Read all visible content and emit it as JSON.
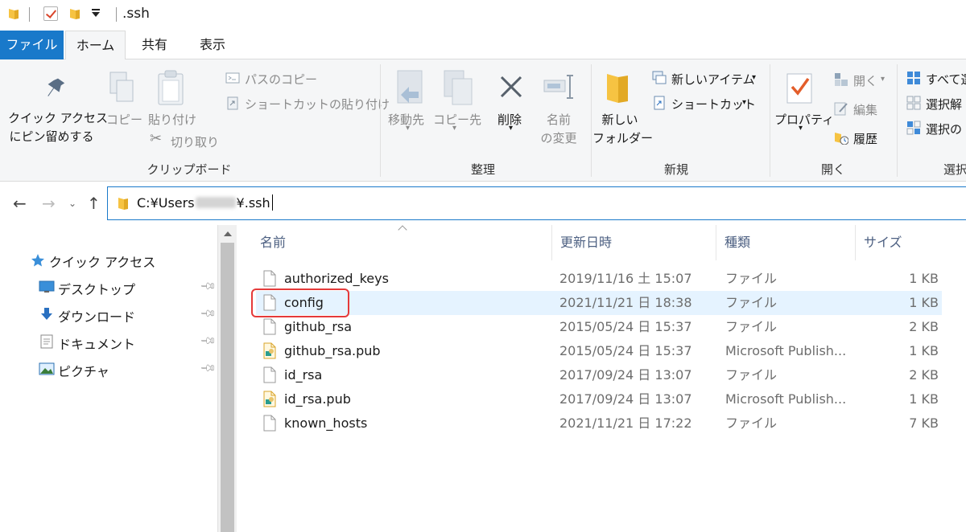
{
  "window": {
    "title": ".ssh"
  },
  "tabs": [
    {
      "label": "ファイル"
    },
    {
      "label": "ホーム"
    },
    {
      "label": "共有"
    },
    {
      "label": "表示"
    }
  ],
  "ribbon": {
    "clipboard": {
      "label": "クリップボード",
      "pin_line1": "クイック アクセス",
      "pin_line2": "にピン留めする",
      "copy": "コピー",
      "paste": "貼り付け",
      "cut": "切り取り",
      "copy_path": "パスのコピー",
      "paste_shortcut": "ショートカットの貼り付け"
    },
    "organize": {
      "label": "整理",
      "move_to": "移動先",
      "copy_to": "コピー先",
      "delete": "削除",
      "rename_line1": "名前",
      "rename_line2": "の変更"
    },
    "new": {
      "label": "新規",
      "new_folder_line1": "新しい",
      "new_folder_line2": "フォルダー",
      "new_item": "新しいアイテム",
      "shortcut": "ショートカット"
    },
    "open": {
      "label": "開く",
      "properties": "プロパティ",
      "open": "開く",
      "edit": "編集",
      "history": "履歴"
    },
    "select": {
      "label": "選択",
      "select_all": "すべて選",
      "select_none": "選択解",
      "invert": "選択の"
    }
  },
  "address": {
    "prefix": "C:¥Users",
    "suffix": "¥.ssh"
  },
  "navpane": {
    "items": [
      {
        "label": "クイック アクセス",
        "icon": "star-icon"
      },
      {
        "label": "デスクトップ",
        "icon": "desktop-icon"
      },
      {
        "label": "ダウンロード",
        "icon": "download-icon"
      },
      {
        "label": "ドキュメント",
        "icon": "document-icon"
      },
      {
        "label": "ピクチャ",
        "icon": "picture-icon"
      }
    ]
  },
  "columns": {
    "name": "名前",
    "date": "更新日時",
    "type": "種類",
    "size": "サイズ"
  },
  "files": [
    {
      "name": "authorized_keys",
      "date": "2019/11/16 土 15:07",
      "type": "ファイル",
      "size": "1 KB",
      "icon": "file-icon"
    },
    {
      "name": "config",
      "date": "2021/11/21 日 18:38",
      "type": "ファイル",
      "size": "1 KB",
      "icon": "file-icon"
    },
    {
      "name": "github_rsa",
      "date": "2015/05/24 日 15:37",
      "type": "ファイル",
      "size": "2 KB",
      "icon": "file-icon"
    },
    {
      "name": "github_rsa.pub",
      "date": "2015/05/24 日 15:37",
      "type": "Microsoft Publish...",
      "size": "1 KB",
      "icon": "publisher-file-icon"
    },
    {
      "name": "id_rsa",
      "date": "2017/09/24 日 13:07",
      "type": "ファイル",
      "size": "2 KB",
      "icon": "file-icon"
    },
    {
      "name": "id_rsa.pub",
      "date": "2017/09/24 日 13:07",
      "type": "Microsoft Publish...",
      "size": "1 KB",
      "icon": "publisher-file-icon"
    },
    {
      "name": "known_hosts",
      "date": "2021/11/21 日 17:22",
      "type": "ファイル",
      "size": "7 KB",
      "icon": "file-icon"
    }
  ],
  "colors": {
    "accent": "#1979ca",
    "selection": "#e5f3ff",
    "highlight_box": "#e53a3a",
    "folder": "#f6c342"
  }
}
